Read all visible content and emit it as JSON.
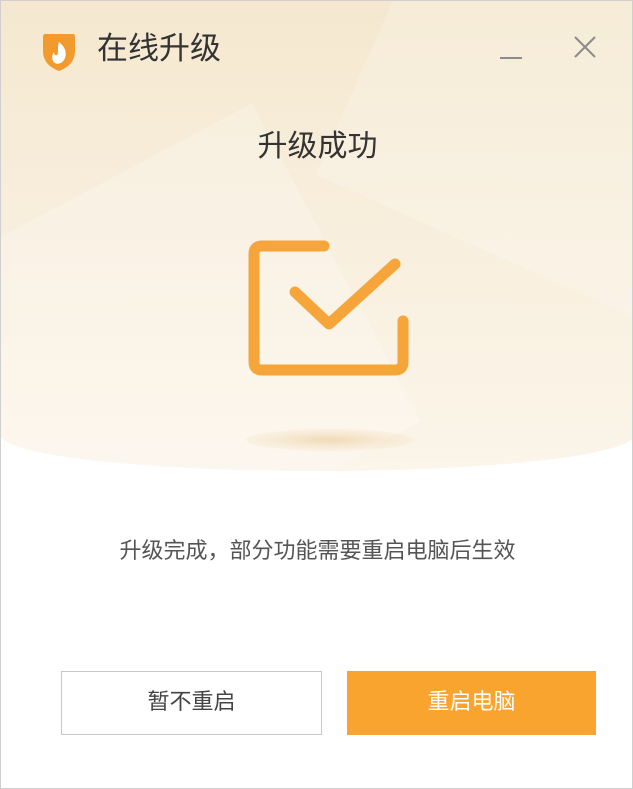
{
  "window": {
    "title": "在线升级",
    "app_icon": "shield-flame-icon",
    "minimize_icon": "minimize-icon",
    "close_icon": "close-icon"
  },
  "status": {
    "headline": "升级成功",
    "icon": "checkmark-box-icon",
    "message": "升级完成，部分功能需要重启电脑后生效"
  },
  "actions": {
    "later_label": "暂不重启",
    "restart_label": "重启电脑"
  },
  "colors": {
    "accent": "#f8a42e",
    "icon_orange": "#f5a53a",
    "hero_background": "#f5e8cf"
  }
}
